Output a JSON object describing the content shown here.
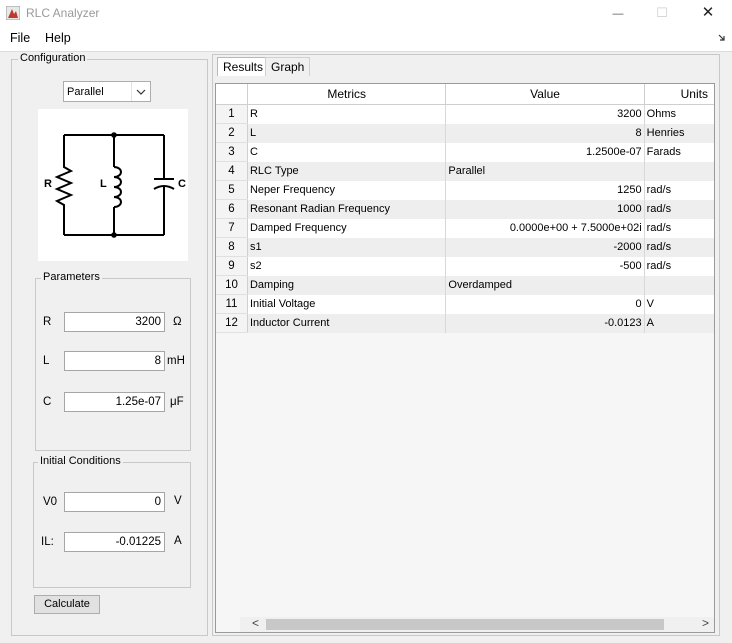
{
  "window": {
    "title": "RLC Analyzer",
    "controls": {
      "minimize": "—",
      "maximize": "☐",
      "close": "✕"
    }
  },
  "menu": {
    "items": [
      "File",
      "Help"
    ]
  },
  "configuration": {
    "title": "Configuration",
    "type_selected": "Parallel",
    "circuit_labels": {
      "r": "R",
      "l": "L",
      "c": "C"
    }
  },
  "parameters": {
    "title": "Parameters",
    "rows": [
      {
        "label": "R",
        "value": "3200",
        "unit": "Ω"
      },
      {
        "label": "L",
        "value": "8",
        "unit": "mH"
      },
      {
        "label": "C",
        "value": "1.25e-07",
        "unit": "μF"
      }
    ]
  },
  "initial_conditions": {
    "title": "Initial Conditions",
    "rows": [
      {
        "label": "V0",
        "value": "0",
        "unit": "V"
      },
      {
        "label": "IL:",
        "value": "-0.01225",
        "unit": "A"
      }
    ]
  },
  "calculate_label": "Calculate",
  "tabs": [
    "Results",
    "Graph"
  ],
  "table": {
    "headers": [
      "Metrics",
      "Value",
      "Units"
    ],
    "rows": [
      {
        "n": "1",
        "metric": "R",
        "value": "3200",
        "unit": "Ohms",
        "align": "right"
      },
      {
        "n": "2",
        "metric": "L",
        "value": "8",
        "unit": "Henries",
        "align": "right"
      },
      {
        "n": "3",
        "metric": "C",
        "value": "1.2500e-07",
        "unit": "Farads",
        "align": "right"
      },
      {
        "n": "4",
        "metric": "RLC Type",
        "value": "Parallel",
        "unit": "",
        "align": "left"
      },
      {
        "n": "5",
        "metric": "Neper Frequency",
        "value": "1250",
        "unit": "rad/s",
        "align": "right"
      },
      {
        "n": "6",
        "metric": "Resonant Radian Frequency",
        "value": "1000",
        "unit": "rad/s",
        "align": "right"
      },
      {
        "n": "7",
        "metric": "Damped Frequency",
        "value": "0.0000e+00 + 7.5000e+02i",
        "unit": "rad/s",
        "align": "right"
      },
      {
        "n": "8",
        "metric": "s1",
        "value": "-2000",
        "unit": "rad/s",
        "align": "right"
      },
      {
        "n": "9",
        "metric": "s2",
        "value": "-500",
        "unit": "rad/s",
        "align": "right"
      },
      {
        "n": "10",
        "metric": "Damping",
        "value": "Overdamped",
        "unit": "",
        "align": "left"
      },
      {
        "n": "11",
        "metric": "Initial Voltage",
        "value": "0",
        "unit": "V",
        "align": "right"
      },
      {
        "n": "12",
        "metric": "Inductor Current",
        "value": "-0.0123",
        "unit": "A",
        "align": "right"
      }
    ]
  },
  "scroll": {
    "left": "<",
    "right": ">"
  }
}
